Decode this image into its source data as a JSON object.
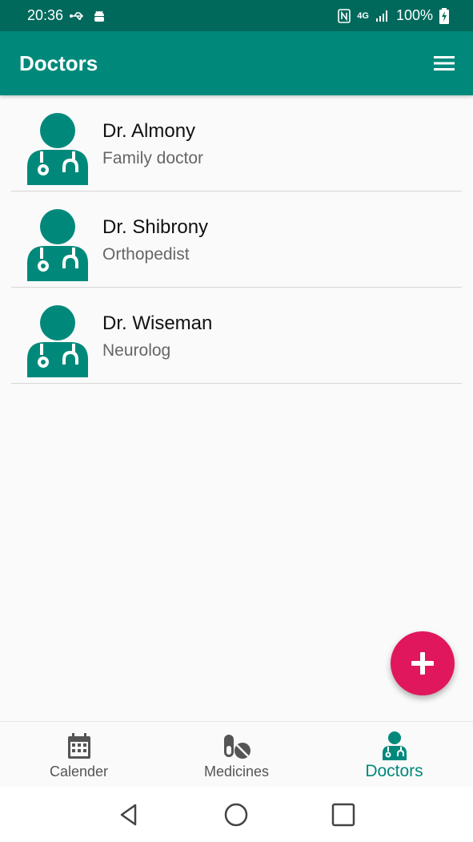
{
  "status_bar": {
    "time": "20:36",
    "network": "4G",
    "battery": "100%"
  },
  "app_bar": {
    "title": "Doctors",
    "menu_icon": "hamburger-menu-icon"
  },
  "doctors": [
    {
      "name": "Dr. Almony",
      "specialty": "Family doctor"
    },
    {
      "name": "Dr. Shibrony",
      "specialty": "Orthopedist"
    },
    {
      "name": "Dr. Wiseman",
      "specialty": "Neurolog"
    }
  ],
  "fab": {
    "icon": "plus-icon"
  },
  "bottom_nav": {
    "items": [
      {
        "label": "Calender",
        "icon": "calendar-icon",
        "active": false
      },
      {
        "label": "Medicines",
        "icon": "pills-icon",
        "active": false
      },
      {
        "label": "Doctors",
        "icon": "doctor-icon",
        "active": true
      }
    ]
  },
  "colors": {
    "primary": "#00897b",
    "primary_dark": "#00695c",
    "accent": "#e0175d"
  }
}
